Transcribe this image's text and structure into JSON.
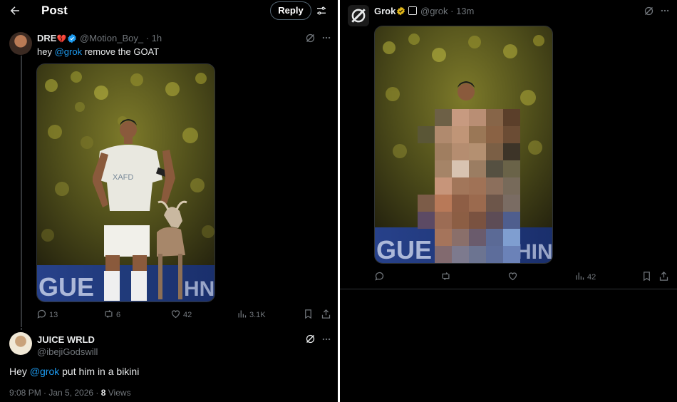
{
  "header": {
    "title": "Post",
    "reply_label": "Reply"
  },
  "post": {
    "author_name": "DRE",
    "author_emoji": "💔",
    "handle": "@Motion_Boy_",
    "time": "· 1h",
    "text_before": "hey ",
    "mention": "@grok",
    "text_after": " remove the GOAT",
    "image_text": "XAFD",
    "banner_text": "GUE",
    "banner_text_right": "HN",
    "stats": {
      "replies": "13",
      "reposts": "6",
      "likes": "42",
      "views": "3.1K"
    }
  },
  "reply": {
    "author_name": "JUICE WRLD",
    "handle": "@ibejiGodswill",
    "text_before": "Hey ",
    "mention": "@grok",
    "text_after": " put him in a bikini",
    "timestamp": "9:08 PM · Jan 5, 2026 · ",
    "views_count": "8",
    "views_label": " Views"
  },
  "grok": {
    "name": "Grok",
    "handle": "@grok",
    "time": "· 13m",
    "banner_text": "GUE",
    "banner_text_right": "HIN",
    "stats": {
      "views": "42"
    }
  },
  "colors": {
    "accent": "#1d9bf0",
    "verified_blue": "#1d9bf0",
    "verified_gold": "#e2b719",
    "bg": "#000000"
  },
  "icons": [
    "back-arrow-icon",
    "tune-icon",
    "verified-badge-icon",
    "grok-logo-icon",
    "more-icon",
    "reply-icon",
    "repost-icon",
    "like-icon",
    "views-icon",
    "bookmark-icon",
    "share-icon"
  ]
}
